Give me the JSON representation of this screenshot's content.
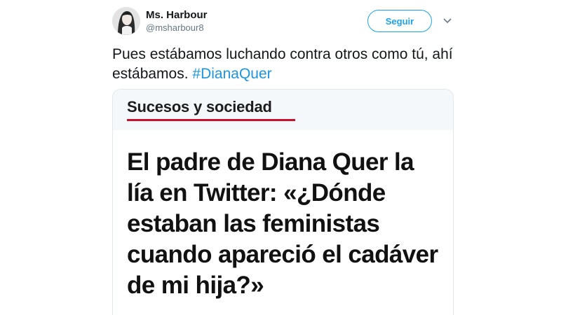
{
  "tweet": {
    "user": {
      "name": "Ms. Harbour",
      "handle": "@msharbour8"
    },
    "follow_label": "Seguir",
    "text_prefix": "Pues estábamos luchando contra otros como tú, ahí estábamos. ",
    "hashtag": "#DianaQuer",
    "colors": {
      "accent": "#1da1f2",
      "hashtag": "#1b95e0",
      "handle": "#657786",
      "section_underline": "#c8102e"
    },
    "icons": {
      "avatar": "profile-photo",
      "menu": "chevron-down-icon"
    }
  },
  "card": {
    "section": "Sucesos y sociedad",
    "headline": "El padre de Diana Quer la lía en Twitter: «¿Dónde estaban las feministas cuando apareció el cadáver de mi hija?»"
  }
}
